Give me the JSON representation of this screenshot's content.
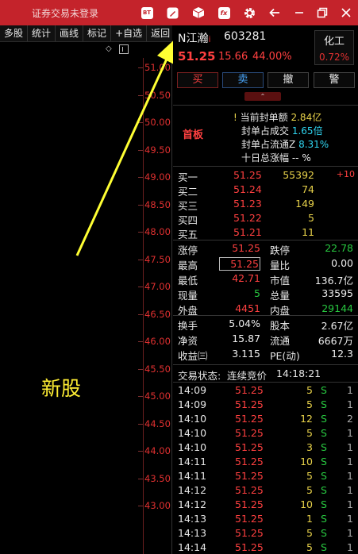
{
  "titlebar": {
    "title": "证券交易未登录",
    "icons": [
      "bt-icon",
      "edit-icon",
      "cube-icon",
      "fx-icon",
      "gear-icon",
      "back-arrow-icon",
      "minimize-icon",
      "restore-icon",
      "close-icon"
    ],
    "bt_label": "BT",
    "fx_label": "fx"
  },
  "toolbar": {
    "items": [
      "多股",
      "统计",
      "画线",
      "标记",
      "+自选",
      "返回"
    ]
  },
  "chart": {
    "y_ticks": [
      "51.00",
      "50.50",
      "50.00",
      "49.50",
      "49.00",
      "48.50",
      "48.00",
      "47.50",
      "47.00",
      "46.50",
      "46.00",
      "45.50",
      "45.00",
      "44.50",
      "44.00",
      "43.50",
      "43.00"
    ],
    "annotation": "新股",
    "arrow_color": "#ffff33"
  },
  "stock": {
    "name": "N江瀚",
    "name_suffix": "i",
    "code": "603281",
    "price": "51.25",
    "change": "15.66",
    "change_pct": "44.00%",
    "sector": "化工",
    "sector_pct": "0.72%"
  },
  "trade_buttons": {
    "buy": "买",
    "sell": "卖",
    "cancel": "撤",
    "alert": "警"
  },
  "seal": {
    "tag": "首板",
    "rows": [
      {
        "label": "当前封单额",
        "value": "2.84亿",
        "color": "yellow",
        "prefix": "!"
      },
      {
        "label": "封单占成交",
        "value": "1.65倍",
        "color": "cyan"
      },
      {
        "label": "封单占流通Z",
        "value": "8.31%",
        "color": "cyan"
      },
      {
        "label": "十日总涨幅",
        "value": "--  %",
        "color": "white"
      }
    ]
  },
  "orders": [
    {
      "label": "买一",
      "price": "51.25",
      "vol": "55392",
      "extra": "+10"
    },
    {
      "label": "买二",
      "price": "51.24",
      "vol": "74",
      "extra": ""
    },
    {
      "label": "买三",
      "price": "51.23",
      "vol": "149",
      "extra": ""
    },
    {
      "label": "买四",
      "price": "51.22",
      "vol": "5",
      "extra": ""
    },
    {
      "label": "买五",
      "price": "51.21",
      "vol": "11",
      "extra": ""
    }
  ],
  "stats": [
    {
      "l1": "涨停",
      "v1": "51.25",
      "c1": "red",
      "l2": "跌停",
      "v2": "22.78",
      "c2": "green"
    },
    {
      "l1": "最高",
      "v1": "51.25",
      "c1": "red",
      "l2": "量比",
      "v2": "0.00",
      "c2": "white",
      "box": true
    },
    {
      "l1": "最低",
      "v1": "42.71",
      "c1": "red",
      "l2": "市值",
      "v2": "136.7亿",
      "c2": "white"
    },
    {
      "l1": "现量",
      "v1": "5",
      "c1": "green",
      "l2": "总量",
      "v2": "33595",
      "c2": "white"
    },
    {
      "l1": "外盘",
      "v1": "4451",
      "c1": "red",
      "l2": "内盘",
      "v2": "29144",
      "c2": "green"
    }
  ],
  "stats2": [
    {
      "l1": "换手",
      "v1": "5.04%",
      "c1": "white",
      "l2": "股本",
      "v2": "2.67亿",
      "c2": "white"
    },
    {
      "l1": "净资",
      "v1": "15.87",
      "c1": "white",
      "l2": "流通",
      "v2": "6667万",
      "c2": "white"
    },
    {
      "l1": "收益㈢",
      "v1": "3.115",
      "c1": "white",
      "l2": "PE(动)",
      "v2": "12.3",
      "c2": "white"
    }
  ],
  "status": {
    "label": "交易状态:",
    "value": "连续竞价",
    "time": "14:18:21"
  },
  "trades": [
    {
      "time": "14:09",
      "price": "51.25",
      "vol": "5",
      "side": "S",
      "n": "1"
    },
    {
      "time": "14:09",
      "price": "51.25",
      "vol": "5",
      "side": "S",
      "n": "1"
    },
    {
      "time": "14:10",
      "price": "51.25",
      "vol": "12",
      "side": "S",
      "n": "2"
    },
    {
      "time": "14:10",
      "price": "51.25",
      "vol": "5",
      "side": "S",
      "n": "1"
    },
    {
      "time": "14:10",
      "price": "51.25",
      "vol": "3",
      "side": "S",
      "n": "1"
    },
    {
      "time": "14:11",
      "price": "51.25",
      "vol": "10",
      "side": "S",
      "n": "1"
    },
    {
      "time": "14:11",
      "price": "51.25",
      "vol": "5",
      "side": "S",
      "n": "1"
    },
    {
      "time": "14:12",
      "price": "51.25",
      "vol": "5",
      "side": "S",
      "n": "1"
    },
    {
      "time": "14:12",
      "price": "51.25",
      "vol": "10",
      "side": "S",
      "n": "1"
    },
    {
      "time": "14:13",
      "price": "51.25",
      "vol": "1",
      "side": "S",
      "n": "1"
    },
    {
      "time": "14:13",
      "price": "51.25",
      "vol": "5",
      "side": "S",
      "n": "1"
    },
    {
      "time": "14:14",
      "price": "51.25",
      "vol": "5",
      "side": "S",
      "n": "1"
    }
  ]
}
